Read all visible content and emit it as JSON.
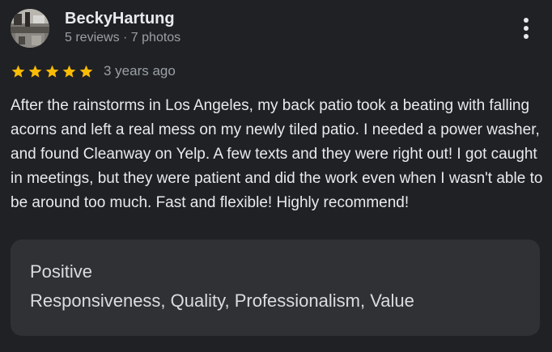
{
  "review": {
    "author": {
      "name": "BeckyHartung",
      "meta": "5 reviews · 7 photos",
      "avatar": "profile-photo"
    },
    "rating": {
      "stars": 5,
      "max": 5,
      "star_color": "#fbbc04"
    },
    "date": "3 years ago",
    "text": "After the rainstorms in Los Angeles, my back patio took a beating with falling acorns and left a real mess on my newly tiled patio. I needed a power washer, and found Cleanway on Yelp. A few texts and they were right out! I got caught in meetings, but they were patient and did the work even when I wasn't able to be around too much. Fast and flexible! Highly recommend!",
    "more_icon": "more-vert-icon",
    "attributes": {
      "heading": "Positive",
      "values": "Responsiveness, Quality, Professionalism, Value"
    }
  },
  "colors": {
    "background": "#202124",
    "card": "#303134",
    "text_primary": "#e8eaed",
    "text_secondary": "#9aa0a6"
  }
}
